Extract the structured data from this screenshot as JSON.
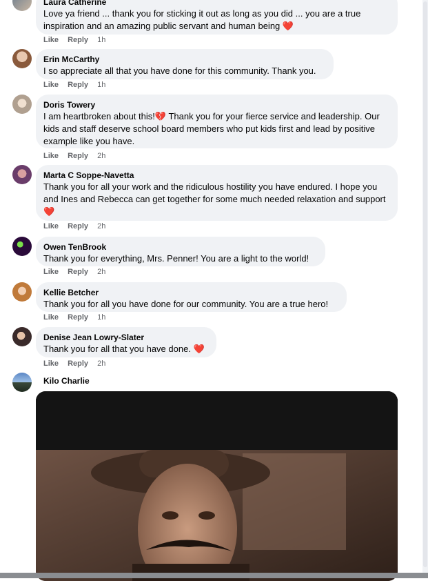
{
  "actions": {
    "like": "Like",
    "reply": "Reply"
  },
  "comments": [
    {
      "author": "Laura Catherine",
      "text": "Love ya friend ... thank you for sticking it out as long as you did ... you are a true inspiration and an amazing public servant and human being",
      "emoji": "❤️",
      "time": "1h"
    },
    {
      "author": "Erin McCarthy",
      "text": "I so appreciate all that you have done for this community. Thank you.",
      "time": "1h"
    },
    {
      "author": "Doris Towery",
      "text_before": "I am heartbroken about this!",
      "emoji": "💔",
      "text_after": " Thank you for your fierce service and leadership. Our kids and staff deserve school board members who put kids first and lead by positive example like you have.",
      "time": "2h"
    },
    {
      "author": "Marta C Soppe-Navetta",
      "text": "Thank you for all your work and the ridiculous hostility you have endured. I hope you and Ines and Rebecca can get together for some much needed relaxation and support",
      "emoji": "❤️",
      "time": "2h"
    },
    {
      "author": "Owen TenBrook",
      "text": "Thank you for everything, Mrs. Penner! You are a light to the world!",
      "time": "2h"
    },
    {
      "author": "Kellie Betcher",
      "text": "Thank you for all you have done for our community. You are a true hero!",
      "time": "1h"
    },
    {
      "author": "Denise Jean Lowry-Slater",
      "text": "Thank you for all that you have done.",
      "emoji": "❤️",
      "time": "2h"
    },
    {
      "author": "Kilo Charlie"
    }
  ],
  "icons": {
    "avatar": "user-avatar",
    "gif": "gif-image"
  },
  "colors": {
    "bubble": "#f0f2f5",
    "meta": "#65676b",
    "heart": "#e41e3f",
    "scrollbar": "#e4e6eb"
  }
}
